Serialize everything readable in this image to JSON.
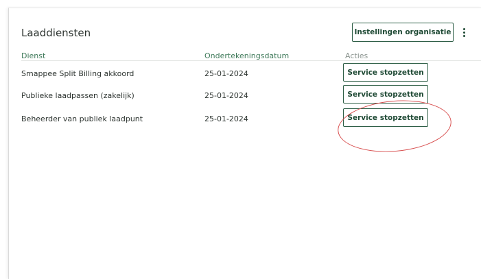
{
  "header": {
    "title": "Laaddiensten",
    "settings_label": "Instellingen organisatie"
  },
  "table": {
    "columns": [
      "Dienst",
      "Ondertekeningsdatum",
      "Acties"
    ],
    "rows": [
      {
        "dienst": "Smappee Split Billing akkoord",
        "datum": "25-01-2024",
        "actie": "Service stopzetten"
      },
      {
        "dienst": "Publieke laadpassen (zakelijk)",
        "datum": "25-01-2024",
        "actie": "Service stopzetten"
      },
      {
        "dienst": "Beheerder van publiek laadpunt",
        "datum": "25-01-2024",
        "actie": "Service stopzetten"
      }
    ]
  },
  "colors": {
    "accent": "#1f4a35",
    "header_text": "#3f7a5a",
    "annotation": "#d85050"
  },
  "icons": {
    "more": "kebab-icon"
  }
}
